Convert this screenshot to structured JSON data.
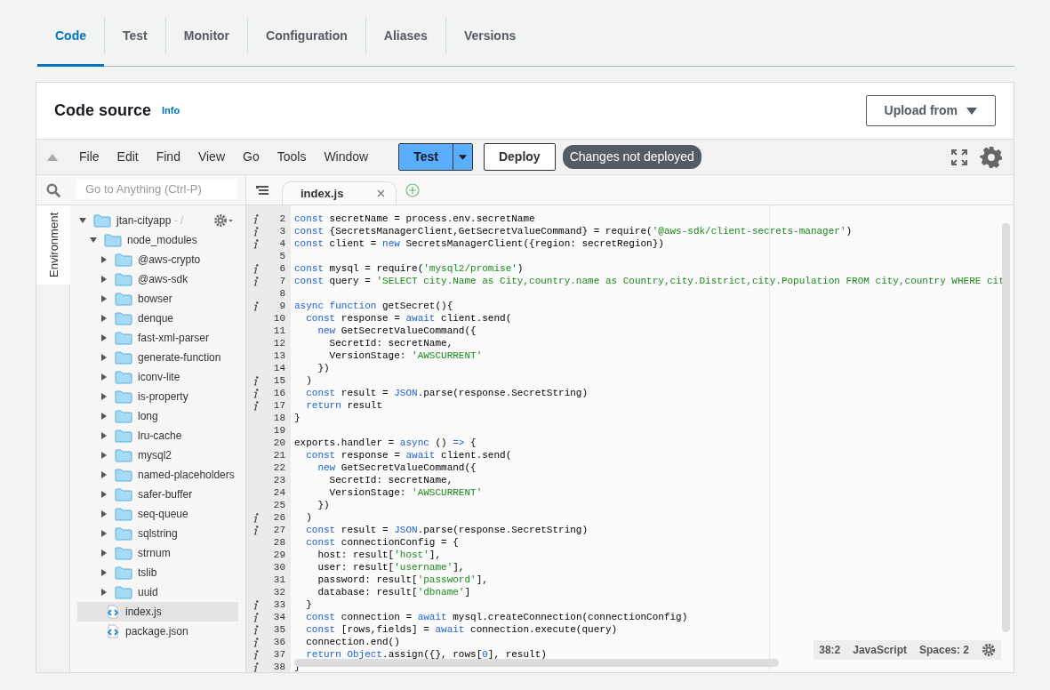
{
  "tabs": [
    {
      "label": "Code",
      "selected": true
    },
    {
      "label": "Test",
      "selected": false
    },
    {
      "label": "Monitor",
      "selected": false
    },
    {
      "label": "Configuration",
      "selected": false
    },
    {
      "label": "Aliases",
      "selected": false
    },
    {
      "label": "Versions",
      "selected": false
    }
  ],
  "header": {
    "title": "Code source",
    "info_link": "Info",
    "upload_button": "Upload from"
  },
  "toolbar": {
    "menu": [
      "File",
      "Edit",
      "Find",
      "View",
      "Go",
      "Tools",
      "Window"
    ],
    "test_button": "Test",
    "deploy_button": "Deploy",
    "status_badge": "Changes not deployed"
  },
  "search": {
    "placeholder": "Go to Anything (Ctrl-P)"
  },
  "side_tab": "Environment",
  "tree": [
    {
      "name": "jtan-cityapp",
      "suffix": " - /",
      "kind": "folder",
      "expanded": true,
      "selected": false,
      "children": [
        {
          "name": "node_modules",
          "kind": "folder",
          "expanded": true,
          "selected": false,
          "children": [
            {
              "name": "@aws-crypto",
              "kind": "folder",
              "expanded": false,
              "selected": false
            },
            {
              "name": "@aws-sdk",
              "kind": "folder",
              "expanded": false,
              "selected": false
            },
            {
              "name": "bowser",
              "kind": "folder",
              "expanded": false,
              "selected": false
            },
            {
              "name": "denque",
              "kind": "folder",
              "expanded": false,
              "selected": false
            },
            {
              "name": "fast-xml-parser",
              "kind": "folder",
              "expanded": false,
              "selected": false
            },
            {
              "name": "generate-function",
              "kind": "folder",
              "expanded": false,
              "selected": false
            },
            {
              "name": "iconv-lite",
              "kind": "folder",
              "expanded": false,
              "selected": false
            },
            {
              "name": "is-property",
              "kind": "folder",
              "expanded": false,
              "selected": false
            },
            {
              "name": "long",
              "kind": "folder",
              "expanded": false,
              "selected": false
            },
            {
              "name": "lru-cache",
              "kind": "folder",
              "expanded": false,
              "selected": false
            },
            {
              "name": "mysql2",
              "kind": "folder",
              "expanded": false,
              "selected": false
            },
            {
              "name": "named-placeholders",
              "kind": "folder",
              "expanded": false,
              "selected": false
            },
            {
              "name": "safer-buffer",
              "kind": "folder",
              "expanded": false,
              "selected": false
            },
            {
              "name": "seq-queue",
              "kind": "folder",
              "expanded": false,
              "selected": false
            },
            {
              "name": "sqlstring",
              "kind": "folder",
              "expanded": false,
              "selected": false
            },
            {
              "name": "strnum",
              "kind": "folder",
              "expanded": false,
              "selected": false
            },
            {
              "name": "tslib",
              "kind": "folder",
              "expanded": false,
              "selected": false
            },
            {
              "name": "uuid",
              "kind": "folder",
              "expanded": false,
              "selected": false
            }
          ]
        },
        {
          "name": "index.js",
          "kind": "file",
          "selected": true
        },
        {
          "name": "package.json",
          "kind": "file",
          "selected": false
        }
      ]
    }
  ],
  "editor_tabs": [
    {
      "label": "index.js",
      "selected": true
    }
  ],
  "code": [
    {
      "n": "2",
      "info": true,
      "tokens": [
        {
          "kind": "keyword",
          "text": "const"
        },
        {
          "kind": "plain",
          "text": " secretName = process.env.secretName"
        }
      ]
    },
    {
      "n": "3",
      "info": true,
      "tokens": [
        {
          "kind": "keyword",
          "text": "const"
        },
        {
          "kind": "plain",
          "text": " {SecretsManagerClient,GetSecretValueCommand} = require("
        },
        {
          "kind": "string",
          "text": "'@aws-sdk/client-secrets-manager'"
        },
        {
          "kind": "plain",
          "text": ")"
        }
      ]
    },
    {
      "n": "4",
      "info": true,
      "tokens": [
        {
          "kind": "keyword",
          "text": "const"
        },
        {
          "kind": "plain",
          "text": " client = "
        },
        {
          "kind": "keyword",
          "text": "new"
        },
        {
          "kind": "plain",
          "text": " SecretsManagerClient({region: secretRegion})"
        }
      ]
    },
    {
      "n": "5",
      "info": false
    },
    {
      "n": "6",
      "info": true,
      "tokens": [
        {
          "kind": "keyword",
          "text": "const"
        },
        {
          "kind": "plain",
          "text": " mysql = require("
        },
        {
          "kind": "string",
          "text": "'mysql2/promise'"
        },
        {
          "kind": "plain",
          "text": ")"
        }
      ]
    },
    {
      "n": "7",
      "info": true,
      "tokens": [
        {
          "kind": "keyword",
          "text": "const"
        },
        {
          "kind": "plain",
          "text": " query = "
        },
        {
          "kind": "string",
          "text": "'SELECT city.Name as City,country.name as Country,city.District,city.Population FROM city,country WHERE cit"
        }
      ]
    },
    {
      "n": "8",
      "info": false
    },
    {
      "n": "9",
      "info": true,
      "tokens": [
        {
          "kind": "keyword",
          "text": "async function"
        },
        {
          "kind": "plain",
          "text": " getSecret(){"
        }
      ]
    },
    {
      "n": "10",
      "info": false,
      "tokens": [
        {
          "kind": "keyword",
          "text": "  const"
        },
        {
          "kind": "plain",
          "text": " response = "
        },
        {
          "kind": "keyword",
          "text": "await"
        },
        {
          "kind": "plain",
          "text": " client.send("
        }
      ]
    },
    {
      "n": "11",
      "info": false,
      "tokens": [
        {
          "kind": "keyword",
          "text": "    new"
        },
        {
          "kind": "plain",
          "text": " GetSecretValueCommand({"
        }
      ]
    },
    {
      "n": "12",
      "info": false,
      "tokens": [
        {
          "kind": "plain",
          "text": "      SecretId: secretName,"
        }
      ]
    },
    {
      "n": "13",
      "info": false,
      "tokens": [
        {
          "kind": "plain",
          "text": "      VersionStage: "
        },
        {
          "kind": "string",
          "text": "'AWSCURRENT'"
        }
      ]
    },
    {
      "n": "14",
      "info": false,
      "tokens": [
        {
          "kind": "plain",
          "text": "    })"
        }
      ]
    },
    {
      "n": "15",
      "info": true,
      "tokens": [
        {
          "kind": "plain",
          "text": "  )"
        }
      ]
    },
    {
      "n": "16",
      "info": true,
      "tokens": [
        {
          "kind": "keyword",
          "text": "  const"
        },
        {
          "kind": "plain",
          "text": " result = "
        },
        {
          "kind": "keyword",
          "text": "JSON"
        },
        {
          "kind": "plain",
          "text": ".parse(response.SecretString)"
        }
      ]
    },
    {
      "n": "17",
      "info": true,
      "tokens": [
        {
          "kind": "keyword",
          "text": "  return"
        },
        {
          "kind": "plain",
          "text": " result"
        }
      ]
    },
    {
      "n": "18",
      "info": false,
      "tokens": [
        {
          "kind": "plain",
          "text": "}"
        }
      ]
    },
    {
      "n": "19",
      "info": false
    },
    {
      "n": "20",
      "info": false,
      "tokens": [
        {
          "kind": "plain",
          "text": "exports.handler = "
        },
        {
          "kind": "keyword",
          "text": "async"
        },
        {
          "kind": "plain",
          "text": " () "
        },
        {
          "kind": "keyword",
          "text": "=>"
        },
        {
          "kind": "plain",
          "text": " {"
        }
      ]
    },
    {
      "n": "21",
      "info": false,
      "tokens": [
        {
          "kind": "keyword",
          "text": "  const"
        },
        {
          "kind": "plain",
          "text": " response = "
        },
        {
          "kind": "keyword",
          "text": "await"
        },
        {
          "kind": "plain",
          "text": " client.send("
        }
      ]
    },
    {
      "n": "22",
      "info": false,
      "tokens": [
        {
          "kind": "keyword",
          "text": "    new"
        },
        {
          "kind": "plain",
          "text": " GetSecretValueCommand({"
        }
      ]
    },
    {
      "n": "23",
      "info": false,
      "tokens": [
        {
          "kind": "plain",
          "text": "      SecretId: secretName,"
        }
      ]
    },
    {
      "n": "24",
      "info": false,
      "tokens": [
        {
          "kind": "plain",
          "text": "      VersionStage: "
        },
        {
          "kind": "string",
          "text": "'AWSCURRENT'"
        }
      ]
    },
    {
      "n": "25",
      "info": false,
      "tokens": [
        {
          "kind": "plain",
          "text": "    })"
        }
      ]
    },
    {
      "n": "26",
      "info": true,
      "tokens": [
        {
          "kind": "plain",
          "text": "  )"
        }
      ]
    },
    {
      "n": "27",
      "info": true,
      "tokens": [
        {
          "kind": "keyword",
          "text": "  const"
        },
        {
          "kind": "plain",
          "text": " result = "
        },
        {
          "kind": "keyword",
          "text": "JSON"
        },
        {
          "kind": "plain",
          "text": ".parse(response.SecretString)"
        }
      ]
    },
    {
      "n": "28",
      "info": false,
      "tokens": [
        {
          "kind": "keyword",
          "text": "  const"
        },
        {
          "kind": "plain",
          "text": " connectionConfig = {"
        }
      ]
    },
    {
      "n": "29",
      "info": false,
      "tokens": [
        {
          "kind": "plain",
          "text": "    host: result["
        },
        {
          "kind": "string",
          "text": "'host'"
        },
        {
          "kind": "plain",
          "text": "],"
        }
      ]
    },
    {
      "n": "30",
      "info": false,
      "tokens": [
        {
          "kind": "plain",
          "text": "    user: result["
        },
        {
          "kind": "string",
          "text": "'username'"
        },
        {
          "kind": "plain",
          "text": "],"
        }
      ]
    },
    {
      "n": "31",
      "info": false,
      "tokens": [
        {
          "kind": "plain",
          "text": "    password: result["
        },
        {
          "kind": "string",
          "text": "'password'"
        },
        {
          "kind": "plain",
          "text": "],"
        }
      ]
    },
    {
      "n": "32",
      "info": false,
      "tokens": [
        {
          "kind": "plain",
          "text": "    database: result["
        },
        {
          "kind": "string",
          "text": "'dbname'"
        },
        {
          "kind": "plain",
          "text": "]"
        }
      ]
    },
    {
      "n": "33",
      "info": true,
      "tokens": [
        {
          "kind": "plain",
          "text": "  }"
        }
      ]
    },
    {
      "n": "34",
      "info": true,
      "tokens": [
        {
          "kind": "keyword",
          "text": "  const"
        },
        {
          "kind": "plain",
          "text": " connection = "
        },
        {
          "kind": "keyword",
          "text": "await"
        },
        {
          "kind": "plain",
          "text": " mysql.createConnection(connectionConfig)"
        }
      ]
    },
    {
      "n": "35",
      "info": true,
      "tokens": [
        {
          "kind": "keyword",
          "text": "  const"
        },
        {
          "kind": "plain",
          "text": " [rows,fields] = "
        },
        {
          "kind": "keyword",
          "text": "await"
        },
        {
          "kind": "plain",
          "text": " connection.execute(query)"
        }
      ]
    },
    {
      "n": "36",
      "info": true,
      "tokens": [
        {
          "kind": "plain",
          "text": "  connection.end()"
        }
      ]
    },
    {
      "n": "37",
      "info": true,
      "tokens": [
        {
          "kind": "keyword",
          "text": "  return"
        },
        {
          "kind": "keyword",
          "text": " Object"
        },
        {
          "kind": "plain",
          "text": ".assign({}, rows["
        },
        {
          "kind": "keyword",
          "text": "0"
        },
        {
          "kind": "plain",
          "text": "], result)"
        }
      ]
    },
    {
      "n": "38",
      "info": true,
      "tokens": [
        {
          "kind": "plain",
          "text": "}"
        }
      ]
    }
  ],
  "status_bar": {
    "position": "38:2",
    "language": "JavaScript",
    "indent": "Spaces: 2"
  }
}
